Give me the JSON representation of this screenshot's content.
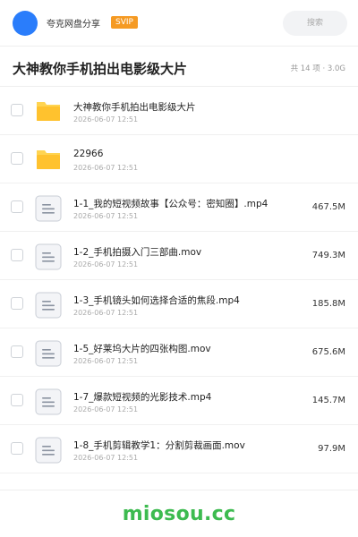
{
  "header": {
    "share_name": "夸克网盘分享",
    "badge": "SVIP",
    "search_placeholder": "搜索"
  },
  "folder": {
    "title": "大神教你手机拍出电影级大片",
    "meta": "共 14 项 · 3.0G"
  },
  "files": [
    {
      "name": "大神教你手机拍出电影级大片",
      "date": "2026-06-07 12:51",
      "size": "",
      "type": "folder"
    },
    {
      "name": "22966",
      "date": "2026-06-07 12:51",
      "size": "",
      "type": "folder"
    },
    {
      "name": "1-1_我的短视频故事【公众号：密知圈】.mp4",
      "date": "2026-06-07 12:51",
      "size": "467.5M",
      "type": "file"
    },
    {
      "name": "1-2_手机拍摄入门三部曲.mov",
      "date": "2026-06-07 12:51",
      "size": "749.3M",
      "type": "file"
    },
    {
      "name": "1-3_手机镜头如何选择合适的焦段.mp4",
      "date": "2026-06-07 12:51",
      "size": "185.8M",
      "type": "file"
    },
    {
      "name": "1-5_好莱坞大片的四张构图.mov",
      "date": "2026-06-07 12:51",
      "size": "675.6M",
      "type": "file"
    },
    {
      "name": "1-7_爆款短视频的光影技术.mp4",
      "date": "2026-06-07 12:51",
      "size": "145.7M",
      "type": "file"
    },
    {
      "name": "1-8_手机剪辑教学1：分割剪裁画面.mov",
      "date": "2026-06-07 12:51",
      "size": "97.9M",
      "type": "file"
    }
  ],
  "watermark": "miosou.cc",
  "colors": {
    "avatar": "#2a7dfb",
    "badge": "#f59a23",
    "folder": "#ffc22e",
    "watermark": "#3dbb50"
  },
  "icons": {
    "folder": "folder-icon",
    "file": "document-icon"
  }
}
